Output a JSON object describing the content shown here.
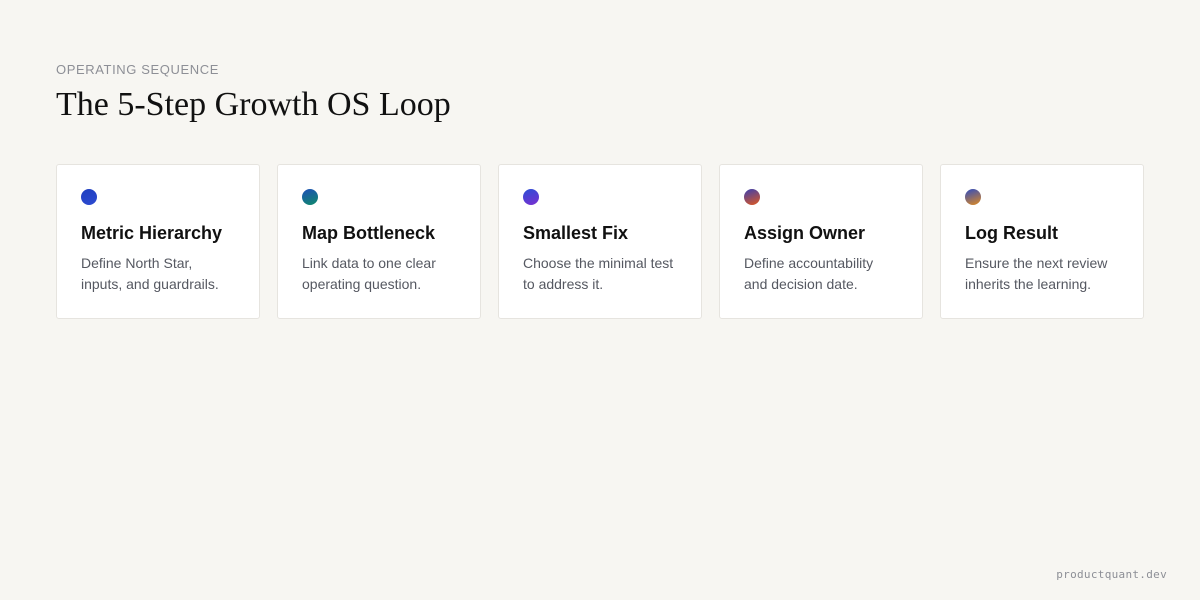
{
  "eyebrow": "OPERATING SEQUENCE",
  "title": "The 5-Step Growth OS Loop",
  "steps": [
    {
      "title": "Metric Hierarchy",
      "description": "Define North Star, inputs, and guardrails.",
      "dot_colors": [
        "#1f3fbf",
        "#2d4bd1"
      ]
    },
    {
      "title": "Map Bottleneck",
      "description": "Link data to one clear operating question.",
      "dot_colors": [
        "#1d4fb8",
        "#0f8a6a"
      ]
    },
    {
      "title": "Smallest Fix",
      "description": "Choose the minimal test to address it.",
      "dot_colors": [
        "#2b4fd6",
        "#7b2fd0"
      ]
    },
    {
      "title": "Assign Owner",
      "description": "Define accountability and decision date.",
      "dot_colors": [
        "#3a3fb0",
        "#e0581f"
      ]
    },
    {
      "title": "Log Result",
      "description": "Ensure the next review inherits the learning.",
      "dot_colors": [
        "#2e4cc0",
        "#e08a1f"
      ]
    }
  ],
  "footer": "productquant.dev"
}
